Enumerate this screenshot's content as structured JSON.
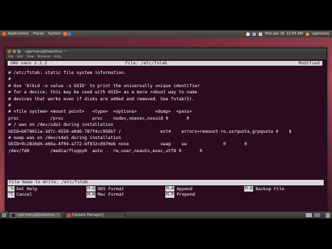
{
  "top_panel": {
    "applications": "Applications",
    "places": "Places",
    "system": "System",
    "clock": "Mon Jan 26, 12:56 AM",
    "user": "cgermany"
  },
  "window": {
    "title": "cgermany@Galactica: ~",
    "menu": [
      "File",
      "Edit",
      "View",
      "Terminal",
      "Help"
    ]
  },
  "nano": {
    "version": "GNU nano 2.2.2",
    "file": "File: /etc/fstab",
    "status": "Modified",
    "lines": [
      "# /etc/fstab: static file system information.",
      "#",
      "# Use 'blkid -o value -s UUID' to print the universally unique identifier",
      "# for a device; this may be used with UUID= as a more robust way to name",
      "# devices that works even if disks are added and removed. See fstab(5).",
      "#",
      "# <file system> <mount point>   <type>  <options>       <dump>  <pass>",
      "proc            /proc           proc    nodev,noexec,nosuid 0       0",
      "# / was on /dev/sda1 during installation",
      "UUID=b078011a-3d7c-4559-a0d6-787f4cc956b7 /               ext4    errors=remount-ro,usrquota,grpquota 0    $",
      "# swap was on /dev/sda5 during installation",
      "UUID=9c2816d4-e86a-4f04-a772-bf932cd970eb none            swap    sw              0       0",
      "/dev/fd0        /media/floppy0  auto    rw,user,noauto,exec,utf8 0       0"
    ],
    "prompt": "File Name to Write: /etc/fstab",
    "shortcuts": [
      [
        {
          "key": "^G",
          "label": "Get Help"
        },
        {
          "key": "M-D",
          "label": "DOS Format"
        },
        {
          "key": "M-A",
          "label": "Append"
        },
        {
          "key": "M-B",
          "label": "Backup File"
        }
      ],
      [
        {
          "key": "^C",
          "label": "Cancel"
        },
        {
          "key": "M-M",
          "label": "Mac Format"
        },
        {
          "key": "M-P",
          "label": "Prepend"
        }
      ]
    ]
  },
  "bottom_panel": {
    "tasks": [
      {
        "label": "cgermany@Galactica: ~"
      },
      {
        "label": "[Update Manager]"
      }
    ]
  },
  "colors": {
    "terminal_bg": "#2c0a22",
    "header_bg": "#d9d9d9"
  }
}
